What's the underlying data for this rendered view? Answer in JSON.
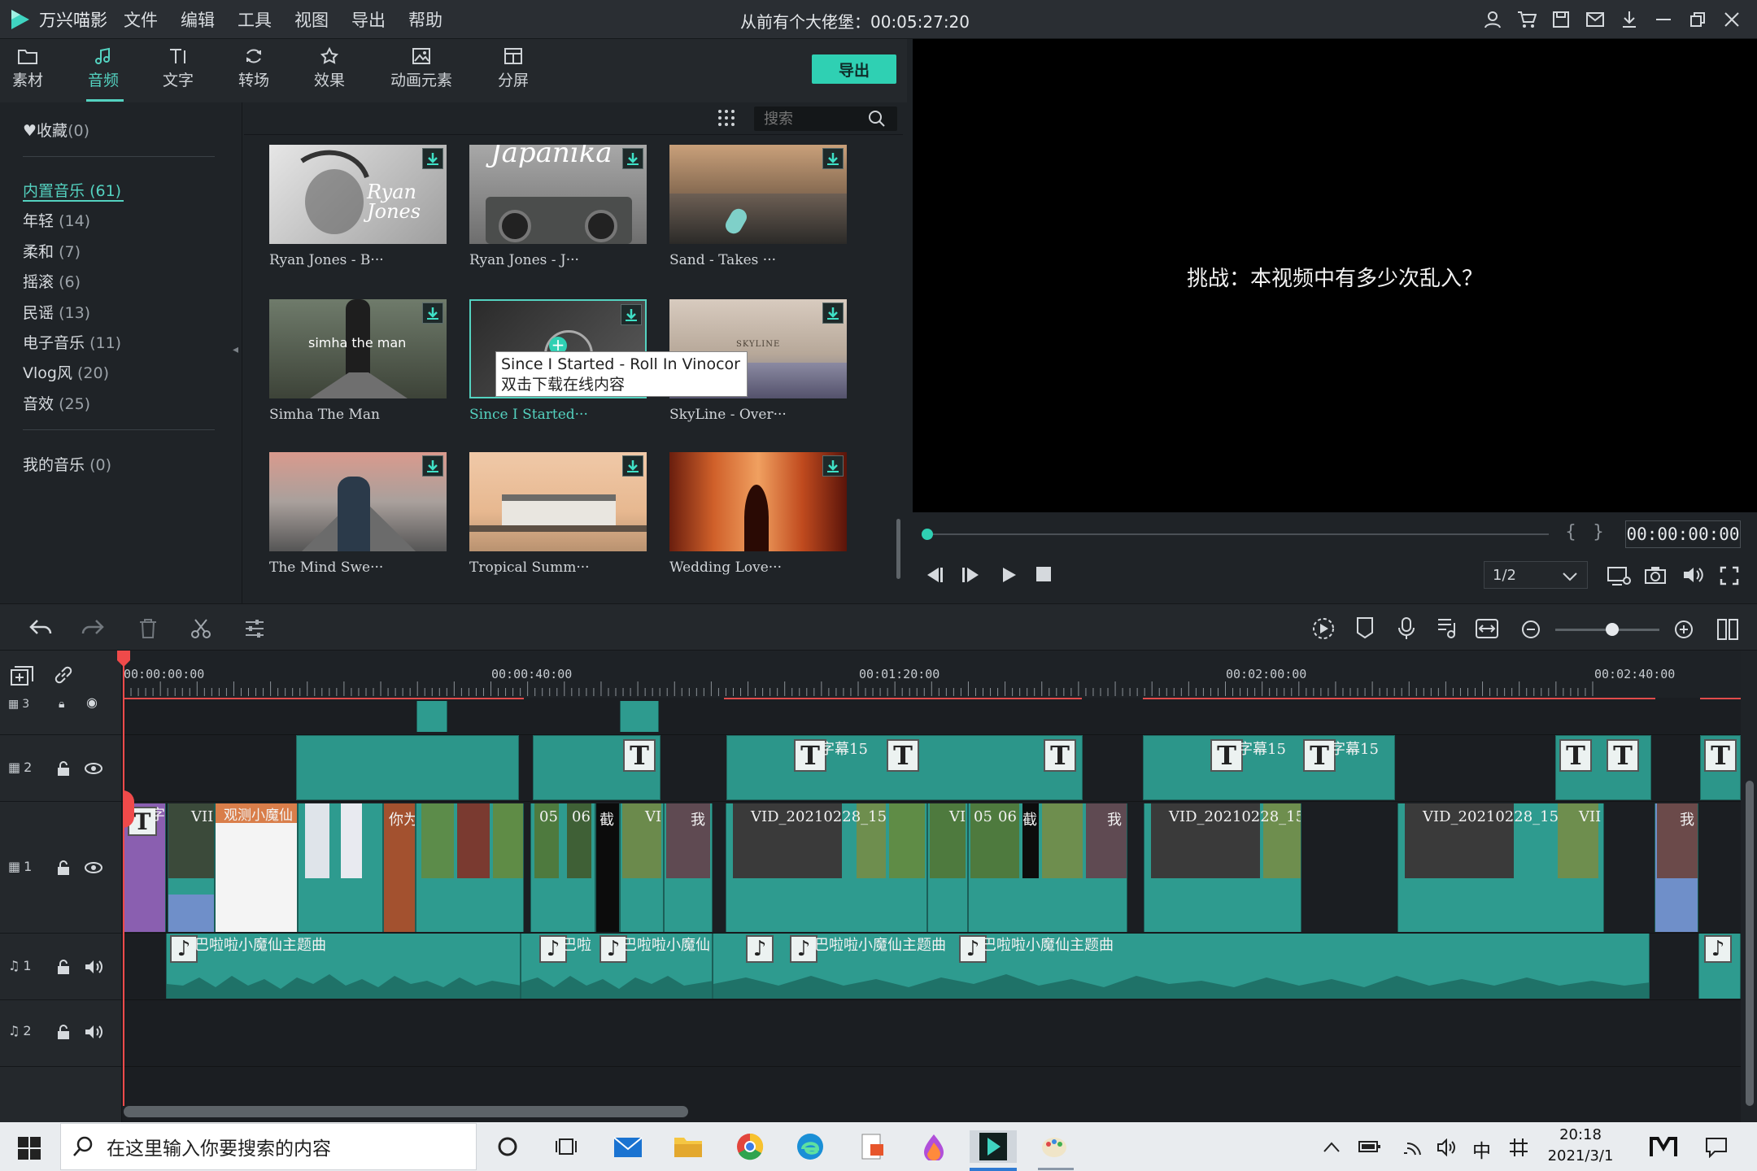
{
  "titlebar": {
    "app_name": "万兴喵影",
    "menus": [
      "文件",
      "编辑",
      "工具",
      "视图",
      "导出",
      "帮助"
    ],
    "project_title": "从前有个大佬堡：00:05:27:20"
  },
  "toolbar": {
    "tabs": [
      {
        "label": "素材",
        "icon": "folder-icon"
      },
      {
        "label": "音频",
        "icon": "music-note-icon"
      },
      {
        "label": "文字",
        "icon": "text-icon"
      },
      {
        "label": "转场",
        "icon": "transition-icon"
      },
      {
        "label": "效果",
        "icon": "effects-icon"
      },
      {
        "label": "动画元素",
        "icon": "elements-icon"
      },
      {
        "label": "分屏",
        "icon": "split-screen-icon"
      }
    ],
    "active_tab": "音频",
    "export_label": "导出"
  },
  "left_panel": {
    "favorites": {
      "label": "收藏",
      "count": "(0)"
    },
    "categories": [
      {
        "label": "内置音乐",
        "count": "(61)"
      },
      {
        "label": "年轻",
        "count": "(14)"
      },
      {
        "label": "柔和",
        "count": "(7)"
      },
      {
        "label": "摇滚",
        "count": "(6)"
      },
      {
        "label": "民谣",
        "count": "(13)"
      },
      {
        "label": "电子音乐",
        "count": "(11)"
      },
      {
        "label": "Vlog风",
        "count": "(20)"
      },
      {
        "label": "音效",
        "count": "(25)"
      }
    ],
    "my_music": {
      "label": "我的音乐",
      "count": "(0)"
    }
  },
  "search": {
    "placeholder": "搜索"
  },
  "music_items": [
    {
      "label": "Ryan Jones - B···"
    },
    {
      "label": "Ryan Jones - J···"
    },
    {
      "label": "Sand - Takes ···"
    },
    {
      "label": "Simha The Man"
    },
    {
      "label": "Since I Started···"
    },
    {
      "label": "SkyLine - Over···"
    },
    {
      "label": "The Mind Swe···"
    },
    {
      "label": "Tropical Summ···"
    },
    {
      "label": "Wedding Love···"
    }
  ],
  "thumb_texts": {
    "t1": "Ryan Jones",
    "t2": "Japanika",
    "t4": "simha the man",
    "t6": "SKYLINE"
  },
  "tooltip": {
    "line1": "Since I Started - Roll In Vinocor",
    "line2": "双击下载在线内容"
  },
  "preview": {
    "caption": "挑战：本视频中有多少次乱入？",
    "timecode": "00:00:00:00",
    "ratio": "1/2"
  },
  "timeline": {
    "ruler": [
      "00:00:00:00",
      "00:00:40:00",
      "00:01:20:00",
      "00:02:00:00",
      "00:02:40:00"
    ],
    "tracks": [
      {
        "label": "3"
      },
      {
        "label": "2"
      },
      {
        "label": "1"
      },
      {
        "label": "1"
      },
      {
        "label": "2"
      }
    ],
    "subtitle_label": "字幕15",
    "video_labels": [
      "VID_20210228_15",
      "VID_20210228_15",
      "VID_20210228_15",
      "观测小魔仙",
      "你为",
      "05",
      "06",
      "截",
      "我",
      "VII",
      "VI",
      "字"
    ],
    "audio_label": "巴啦啦小魔仙主题曲",
    "audio_short": [
      "巴啦",
      "巴啦啦小魔仙",
      "巴啦啦小魔仙主题曲"
    ]
  },
  "taskbar": {
    "search_placeholder": "在这里输入你要搜索的内容",
    "ime": "中",
    "time": "20:18",
    "date": "2021/3/1"
  }
}
